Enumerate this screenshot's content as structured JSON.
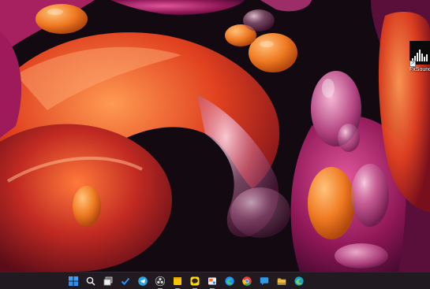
{
  "desktop": {
    "icons": [
      {
        "label": "FxSound",
        "icon": "fxsound-icon"
      }
    ]
  },
  "taskbar": {
    "items": [
      {
        "icon": "windows-start-icon"
      },
      {
        "icon": "search-icon"
      },
      {
        "icon": "task-view-icon"
      },
      {
        "icon": "todo-checkmark-icon"
      },
      {
        "icon": "telegram-icon"
      },
      {
        "icon": "obs-icon"
      },
      {
        "icon": "sticky-notes-icon"
      },
      {
        "icon": "kakaotalk-icon"
      },
      {
        "icon": "snipping-tool-icon"
      },
      {
        "icon": "edge-icon"
      },
      {
        "icon": "chrome-icon"
      },
      {
        "icon": "chat-icon"
      },
      {
        "icon": "file-explorer-icon"
      },
      {
        "icon": "edge-beta-icon"
      }
    ],
    "colors": {
      "start": "#2f8ff0",
      "accent": "#1e90ff",
      "sticky": "#f7c600",
      "kakao": "#f9e000",
      "folder": "#f3c043",
      "chrome_red": "#e94235",
      "chrome_green": "#34a853",
      "chrome_yellow": "#fbbc04"
    }
  }
}
